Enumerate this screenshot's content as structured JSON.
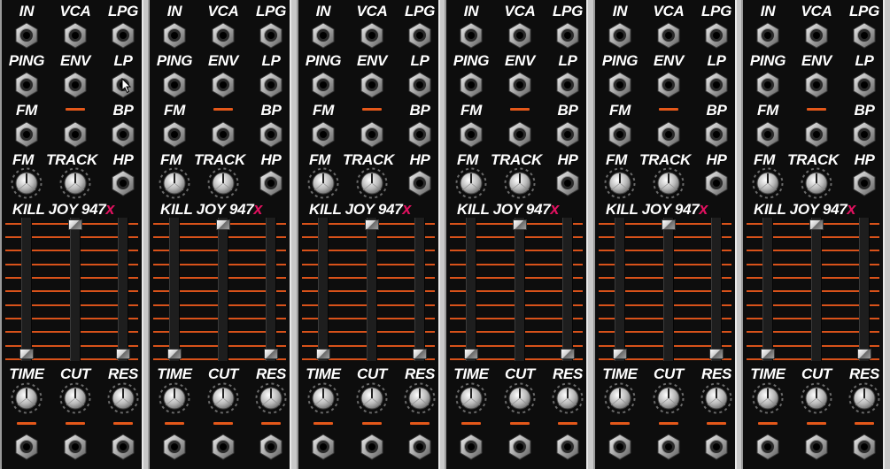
{
  "module_count": 6,
  "labels": {
    "row1": [
      "IN",
      "VCA",
      "LPG"
    ],
    "row2": [
      "PING",
      "ENV",
      "LP"
    ],
    "row3": [
      "FM",
      "BP"
    ],
    "row4": [
      "FM",
      "TRACK",
      "HP"
    ],
    "title": "KILL JOY 947",
    "brand_mark": "x",
    "bottom": [
      "TIME",
      "CUT",
      "RES"
    ]
  },
  "slider_levels": [
    0.0,
    1.0,
    0.0
  ],
  "colors": {
    "panel": "#0d0d0d",
    "text": "#ffffff",
    "accent_orange": "#d8521a",
    "brand_pink": "#e0115f",
    "rack_gap": "#c8c8c8"
  },
  "icons": {
    "jack": "hex-jack-icon",
    "knob": "knob-icon",
    "cursor": "mouse-cursor-icon"
  }
}
